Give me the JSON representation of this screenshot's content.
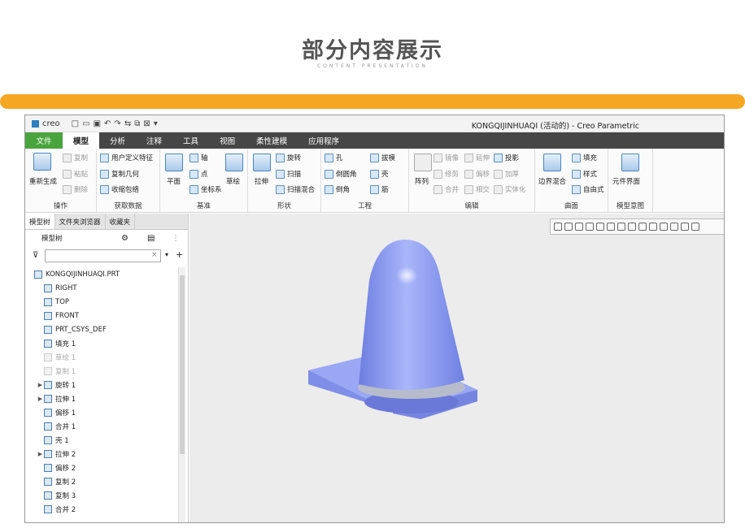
{
  "slide": {
    "title": "部分内容展示",
    "subtitle": "CONTENT PRESENTATION"
  },
  "colors": {
    "accent_bar": "#f5a623",
    "file_tab": "#4aa43d",
    "model": "#8e9ef0"
  },
  "app": {
    "logo": "creo",
    "window_title": "KONGQIJINHUAQI (活动的) - Creo Parametric"
  },
  "tabs": [
    "文件",
    "模型",
    "分析",
    "注释",
    "工具",
    "视图",
    "柔性建模",
    "应用程序"
  ],
  "ribbon": {
    "ops": {
      "regen": "重新生成",
      "copy": "复制",
      "paste": "粘贴",
      "delete": "删除",
      "label": "操作"
    },
    "get": {
      "udf": "用户定义特征",
      "copy_geom": "复制几何",
      "shrinkwrap": "收缩包络",
      "label": "获取数据"
    },
    "datum": {
      "plane": "平面",
      "axis": "轴",
      "point": "点",
      "csys": "坐标系",
      "sketch": "草绘",
      "label": "基准"
    },
    "shapes": {
      "extrude": "拉伸",
      "revolve": "旋转",
      "sweep": "扫描",
      "blend": "扫描混合",
      "label": "形状"
    },
    "eng": {
      "hole": "孔",
      "round": "倒圆角",
      "chamfer": "倒角",
      "draft": "拔模",
      "shell": "壳",
      "rib": "筋",
      "label": "工程"
    },
    "edit": {
      "pattern": "阵列",
      "mirror": "镜像",
      "trim": "修剪",
      "merge": "合并",
      "extend": "延伸",
      "offset": "偏移",
      "intersect": "相交",
      "project": "投影",
      "thicken": "加厚",
      "solidify": "实体化",
      "label": "编辑"
    },
    "surf": {
      "boundary": "边界混合",
      "fill": "填充",
      "style": "样式",
      "freestyle": "自由式",
      "label": "曲面"
    },
    "intent": {
      "component": "元件界面",
      "label": "模型意图"
    }
  },
  "left": {
    "tabs": [
      "模型树",
      "文件夹浏览器",
      "收藏夹"
    ],
    "header": "模型树",
    "tree": [
      {
        "label": "KONGQIJINHUAQI.PRT",
        "exp": "",
        "dim": false
      },
      {
        "label": "RIGHT",
        "exp": "",
        "dim": false
      },
      {
        "label": "TOP",
        "exp": "",
        "dim": false
      },
      {
        "label": "FRONT",
        "exp": "",
        "dim": false
      },
      {
        "label": "PRT_CSYS_DEF",
        "exp": "",
        "dim": false
      },
      {
        "label": "填充 1",
        "exp": "",
        "dim": false
      },
      {
        "label": "草绘 1",
        "exp": "",
        "dim": true
      },
      {
        "label": "复制 1",
        "exp": "",
        "dim": true
      },
      {
        "label": "旋转 1",
        "exp": "▶",
        "dim": false
      },
      {
        "label": "拉伸 1",
        "exp": "▶",
        "dim": false
      },
      {
        "label": "偏移 1",
        "exp": "",
        "dim": false
      },
      {
        "label": "合并 1",
        "exp": "",
        "dim": false
      },
      {
        "label": "壳 1",
        "exp": "",
        "dim": false
      },
      {
        "label": "拉伸 2",
        "exp": "▶",
        "dim": false
      },
      {
        "label": "偏移 2",
        "exp": "",
        "dim": false
      },
      {
        "label": "复制 2",
        "exp": "",
        "dim": false
      },
      {
        "label": "复制 3",
        "exp": "",
        "dim": false
      },
      {
        "label": "合并 2",
        "exp": "",
        "dim": false
      }
    ]
  }
}
